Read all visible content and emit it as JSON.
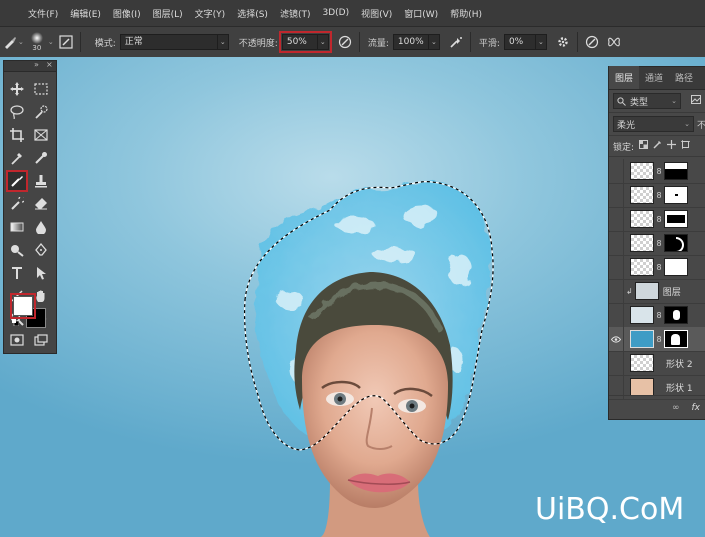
{
  "menubar": {
    "items": [
      "文件(F)",
      "编辑(E)",
      "图像(I)",
      "图层(L)",
      "文字(Y)",
      "选择(S)",
      "滤镜(T)",
      "3D(D)",
      "视图(V)",
      "窗口(W)",
      "帮助(H)"
    ]
  },
  "options": {
    "brush_size": "30",
    "mode_label": "模式:",
    "mode_value": "正常",
    "opacity_label": "不透明度:",
    "opacity_value": "50%",
    "flow_label": "流量:",
    "flow_value": "100%",
    "smooth_label": "平滑:",
    "smooth_value": "0%"
  },
  "layers": {
    "tabs": [
      "图层",
      "通道",
      "路径"
    ],
    "filter_label": "类型",
    "blend_mode": "柔光",
    "lock_label": "锁定:",
    "rows": [
      {
        "name": "",
        "visible": false
      },
      {
        "name": "",
        "visible": false
      },
      {
        "name": "",
        "visible": false
      },
      {
        "name": "",
        "visible": false
      },
      {
        "name": "",
        "visible": false
      },
      {
        "name": "图层",
        "visible": false
      },
      {
        "name": "",
        "visible": false
      },
      {
        "name": "",
        "visible": true,
        "selected": true
      },
      {
        "name": "形状 2",
        "visible": false
      },
      {
        "name": "形状 1",
        "visible": false
      }
    ],
    "footer_fx": "fx"
  },
  "colors": {
    "highlight": "#c0272d",
    "foreground": "#ffffff",
    "background": "#000000",
    "canvas_bg": "#8fc6dd"
  },
  "watermark": "UiBQ.CoM"
}
